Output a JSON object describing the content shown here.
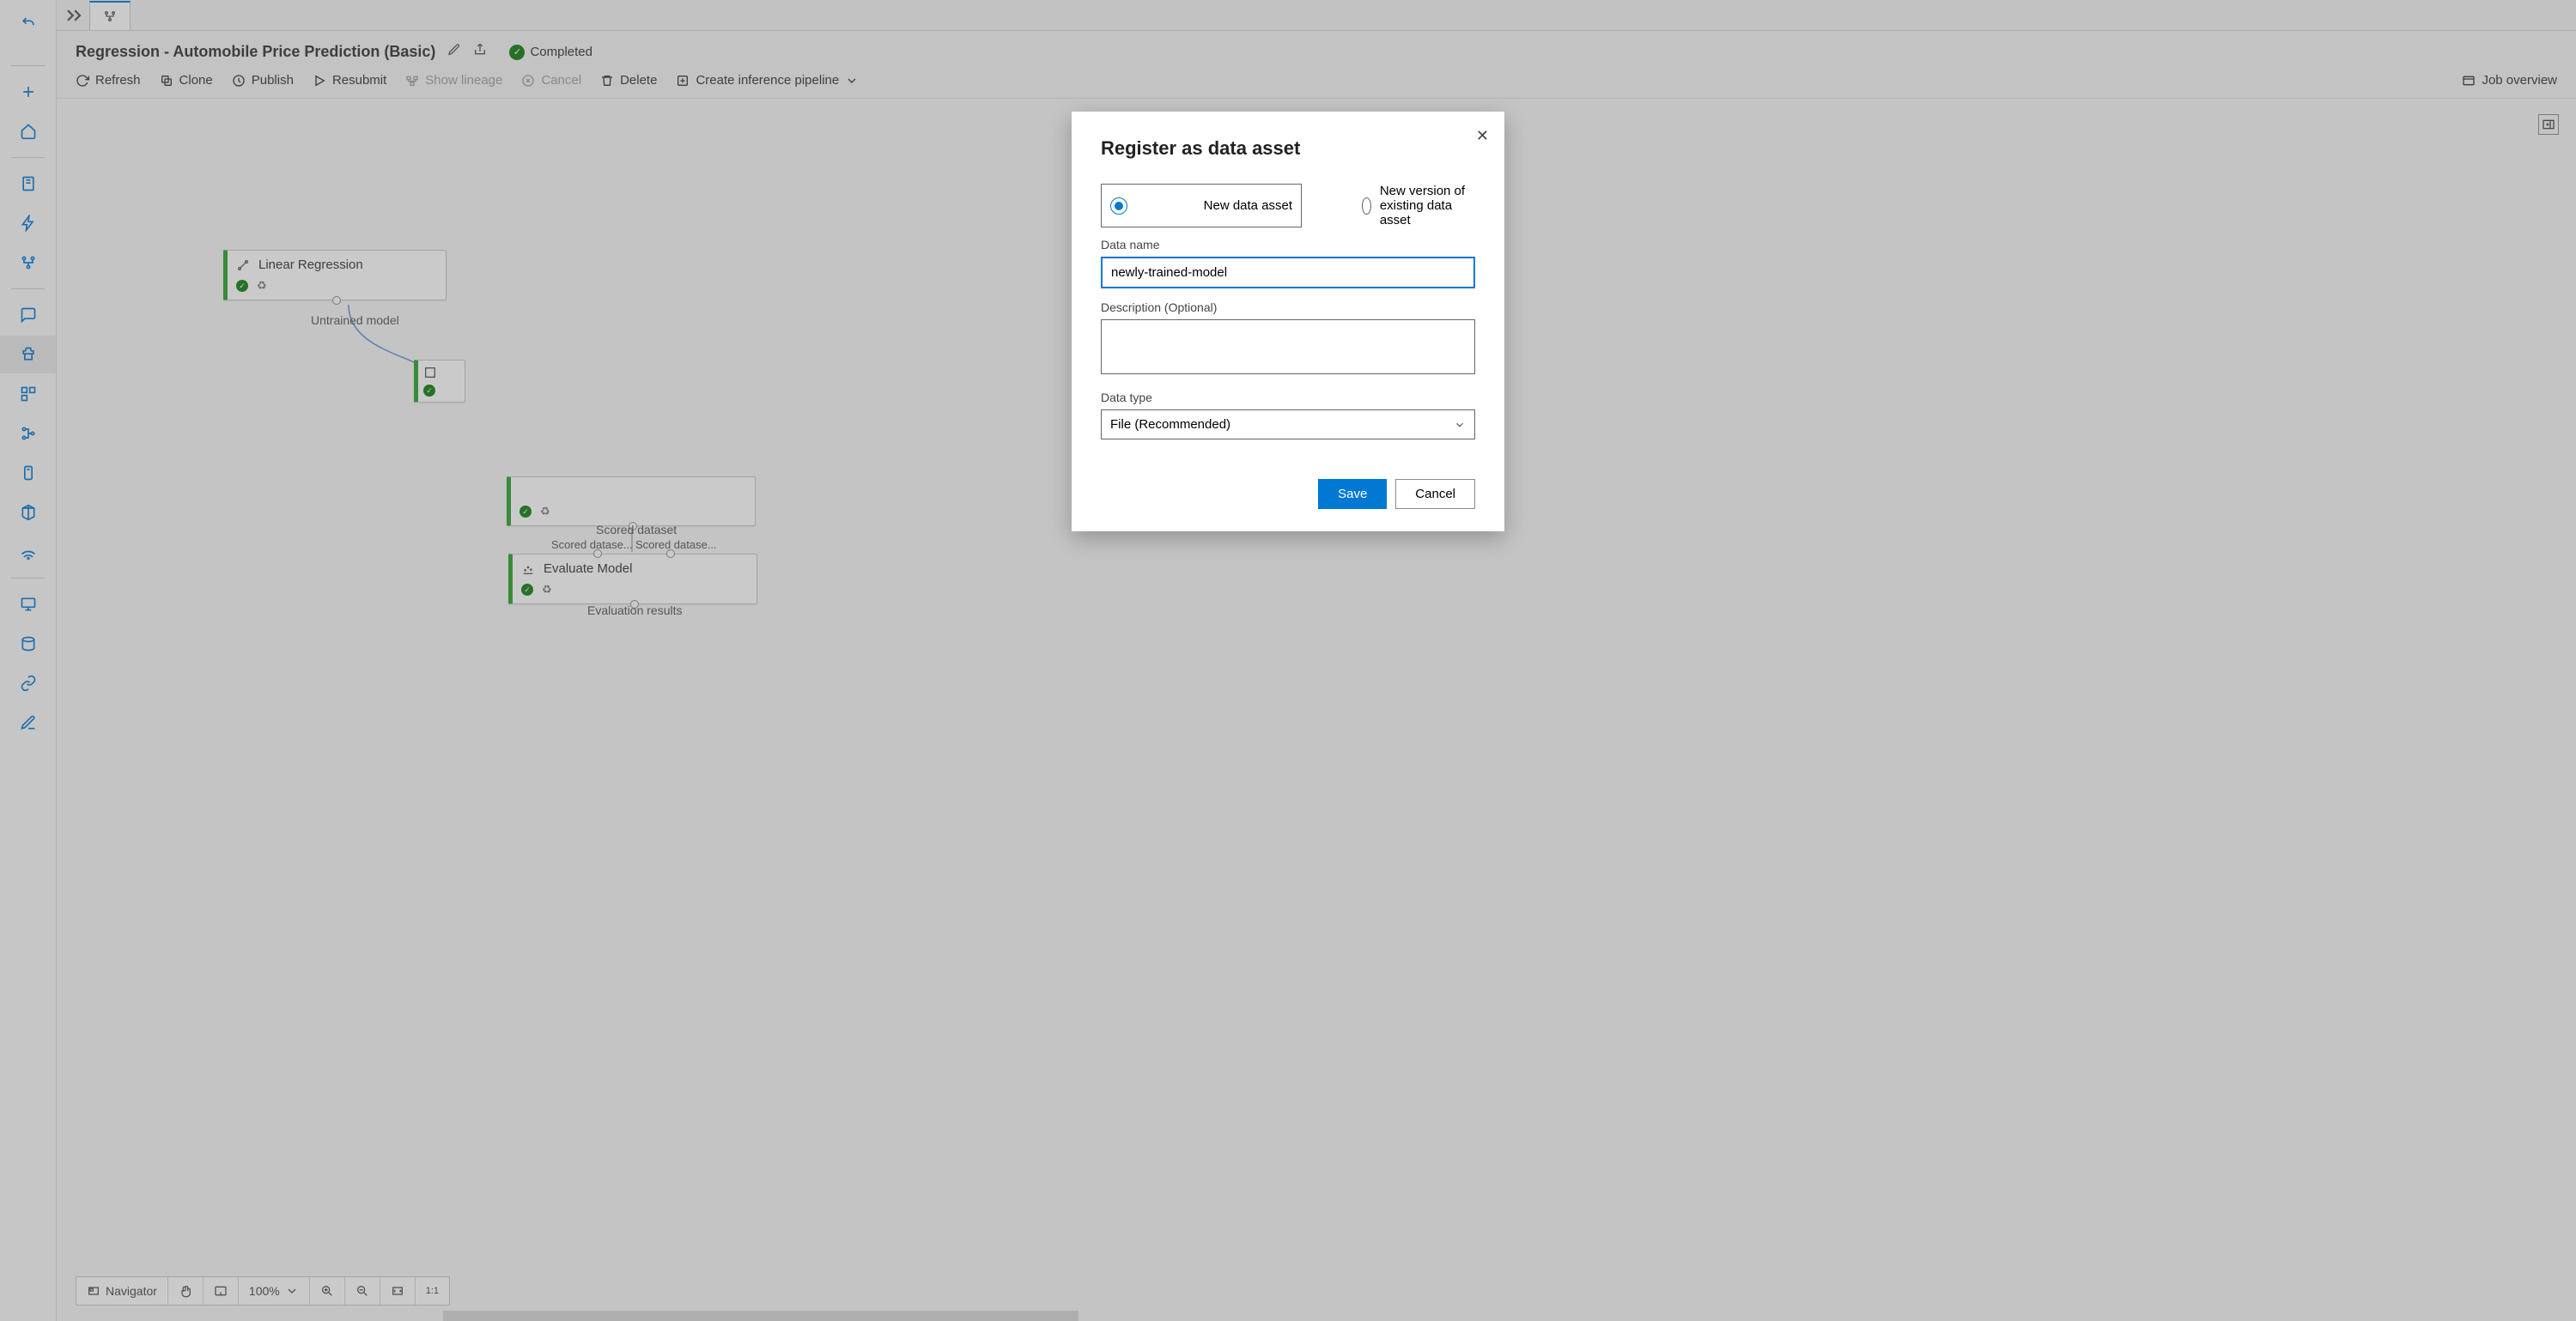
{
  "header": {
    "title": "Regression - Automobile Price Prediction (Basic)",
    "status_label": "Completed"
  },
  "toolbar": {
    "refresh": "Refresh",
    "clone": "Clone",
    "publish": "Publish",
    "resubmit": "Resubmit",
    "show_lineage": "Show lineage",
    "cancel": "Cancel",
    "delete": "Delete",
    "create_inference": "Create inference pipeline",
    "job_overview": "Job overview"
  },
  "nodes": {
    "linear_regression": {
      "label": "Linear Regression"
    },
    "evaluate_model": {
      "label": "Evaluate Model"
    }
  },
  "edge_labels": {
    "untrained_model": "Untrained model",
    "scored_dataset": "Scored dataset",
    "scored_left": "Scored datase...",
    "scored_right": "Scored datase...",
    "eval_results": "Evaluation results"
  },
  "bottombar": {
    "navigator": "Navigator",
    "zoom": "100%"
  },
  "modal": {
    "title": "Register as data asset",
    "opt_new": "New data asset",
    "opt_version": "New version of existing data asset",
    "data_name_label": "Data name",
    "data_name_value": "newly-trained-model",
    "desc_label": "Description (Optional)",
    "desc_value": "",
    "type_label": "Data type",
    "type_value": "File (Recommended)",
    "save": "Save",
    "cancel": "Cancel"
  }
}
